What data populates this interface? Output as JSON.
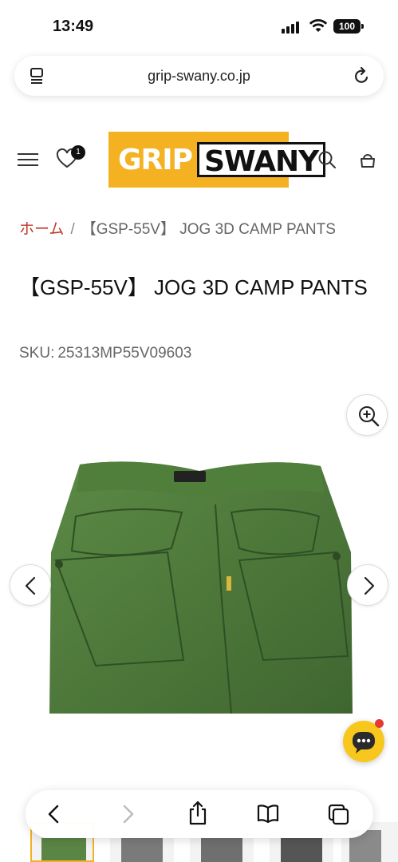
{
  "status_bar": {
    "time": "13:49",
    "battery": "100"
  },
  "browser": {
    "url": "grip-swany.co.jp"
  },
  "header": {
    "wishlist_count": "1",
    "logo_part1": "GRIP",
    "logo_part2": "SWANY",
    "brand_color": "#f4b223"
  },
  "breadcrumb": {
    "home": "ホーム",
    "separator": "/",
    "current": "【GSP-55V】 JOG 3D CAMP PANTS"
  },
  "product": {
    "title": "【GSP-55V】 JOG 3D CAMP PANTS",
    "sku_label": "SKU:",
    "sku_value": "25313MP55V09603",
    "image_color": "#4f7a3a"
  },
  "icons": {
    "menu": "hamburger-menu-icon",
    "wishlist": "heart-icon",
    "search": "search-icon",
    "cart": "bag-icon",
    "zoom": "zoom-in-icon",
    "prev": "chevron-left-icon",
    "next": "chevron-right-icon",
    "chat": "chat-icon",
    "back": "back-icon",
    "forward": "forward-icon",
    "share": "share-icon",
    "bookmarks": "book-icon",
    "tabs": "tabs-icon"
  }
}
